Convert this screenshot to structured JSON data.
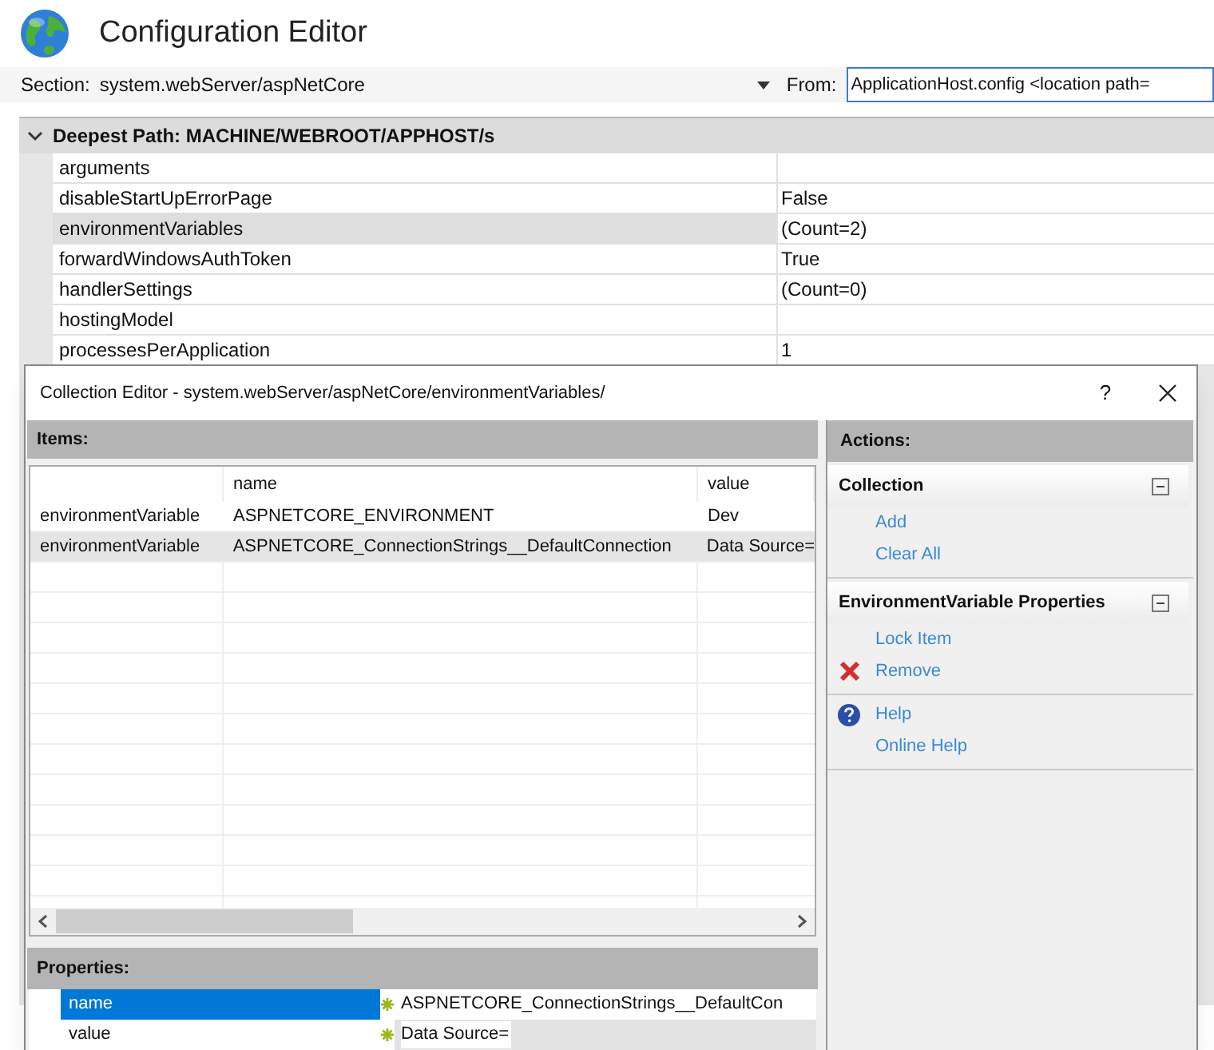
{
  "window": {
    "title": "Configuration Editor"
  },
  "section": {
    "label": "Section:",
    "value": "system.webServer/aspNetCore"
  },
  "from": {
    "label": "From:",
    "value": "ApplicationHost.config <location path="
  },
  "grid": {
    "header": "Deepest Path: MACHINE/WEBROOT/APPHOST/s",
    "expanded": true,
    "rows": [
      {
        "name": "arguments",
        "selected": false
      },
      {
        "name": "disableStartUpErrorPage",
        "value": "False",
        "selected": false
      },
      {
        "name": "environmentVariables",
        "value": "(Count=2)",
        "selected": true
      },
      {
        "name": "forwardWindowsAuthToken",
        "value": "True",
        "selected": false
      },
      {
        "name": "handlerSettings",
        "value": "(Count=0)",
        "selected": false
      },
      {
        "name": "hostingModel",
        "selected": false
      },
      {
        "name": "processesPerApplication",
        "value": "1",
        "selected": false
      }
    ]
  },
  "dialog": {
    "title": "Collection Editor - system.webServer/aspNetCore/environmentVariables/",
    "help": "?",
    "items": {
      "title": "Items:",
      "columns": [
        "name",
        "value"
      ],
      "rows": [
        {
          "column_1": "environmentVariable",
          "name": "ASPNETCORE_ENVIRONMENT",
          "value": "Dev",
          "selected": false
        },
        {
          "column_1": "environmentVariable",
          "name": "ASPNETCORE_ConnectionStrings__DefaultConnection",
          "value": "Data Source=",
          "selected": true
        }
      ]
    },
    "properties": {
      "title": "Properties:",
      "rows": [
        {
          "name": "name",
          "value": "ASPNETCORE_ConnectionStrings__DefaultCon",
          "selected": true,
          "redacted": false
        },
        {
          "name": "value",
          "value": "Data Source=",
          "selected": false,
          "redacted": true
        }
      ]
    },
    "actions": {
      "title": "Actions:",
      "groups": [
        {
          "title": "Collection",
          "expanded": true,
          "items": [
            {
              "label": "Add",
              "kind": "plain"
            },
            {
              "label": "Clear All",
              "kind": "plain"
            }
          ]
        },
        {
          "title": "EnvironmentVariable Properties",
          "expanded": true,
          "items": [
            {
              "label": "Lock Item",
              "kind": "plain"
            },
            {
              "label": "Remove",
              "kind": "remove"
            }
          ]
        },
        {
          "items": [
            {
              "label": "Help",
              "kind": "help"
            },
            {
              "label": "Online Help",
              "kind": "plain"
            }
          ]
        }
      ]
    }
  }
}
